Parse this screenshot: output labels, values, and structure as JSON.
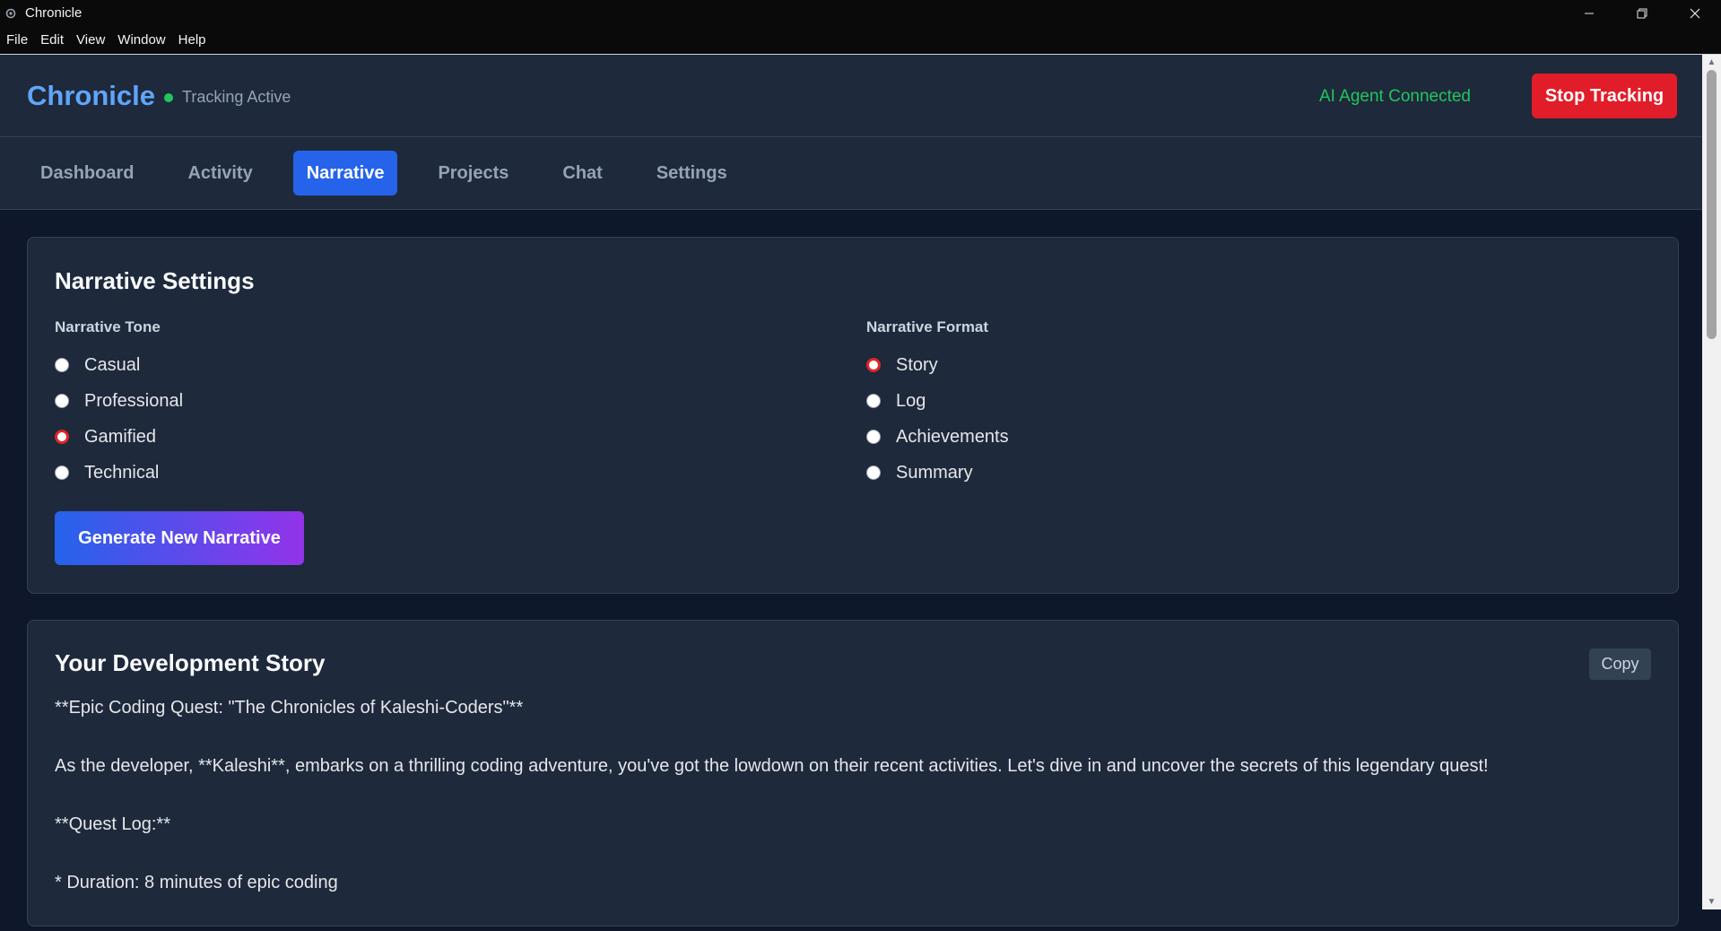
{
  "window": {
    "title": "Chronicle"
  },
  "menu": [
    "File",
    "Edit",
    "View",
    "Window",
    "Help"
  ],
  "header": {
    "brand": "Chronicle",
    "status": "Tracking Active",
    "agent_status": "AI Agent Connected",
    "stop_button": "Stop Tracking"
  },
  "tabs": [
    {
      "label": "Dashboard",
      "active": false
    },
    {
      "label": "Activity",
      "active": false
    },
    {
      "label": "Narrative",
      "active": true
    },
    {
      "label": "Projects",
      "active": false
    },
    {
      "label": "Chat",
      "active": false
    },
    {
      "label": "Settings",
      "active": false
    }
  ],
  "settings": {
    "title": "Narrative Settings",
    "tone": {
      "label": "Narrative Tone",
      "options": [
        "Casual",
        "Professional",
        "Gamified",
        "Technical"
      ],
      "selected": "Gamified"
    },
    "format": {
      "label": "Narrative Format",
      "options": [
        "Story",
        "Log",
        "Achievements",
        "Summary"
      ],
      "selected": "Story"
    },
    "generate_button": "Generate New Narrative"
  },
  "story": {
    "title": "Your Development Story",
    "copy_button": "Copy",
    "paragraphs": [
      "**Epic Coding Quest: \"The Chronicles of Kaleshi-Coders\"**",
      "As the developer, **Kaleshi**, embarks on a thrilling coding adventure, you've got the lowdown on their recent activities. Let's dive in and uncover the secrets of this legendary quest!",
      "**Quest Log:**",
      "* Duration: 8 minutes of epic coding"
    ]
  },
  "colors": {
    "accent": "#2563eb",
    "brand": "#60a5fa",
    "success": "#22c55e",
    "danger": "#e11d2a",
    "background": "#0f172a",
    "card": "#1e293b"
  }
}
